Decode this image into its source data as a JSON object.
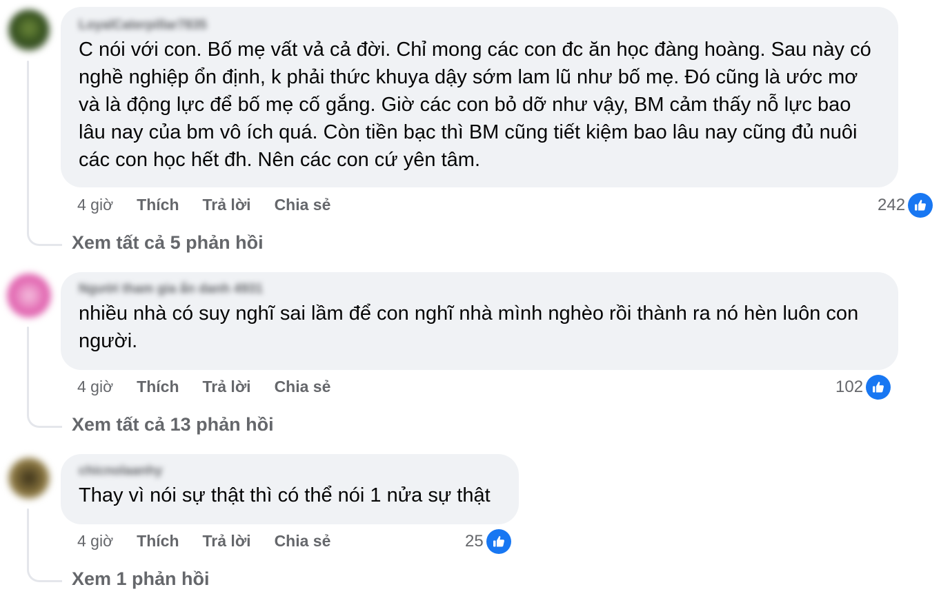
{
  "comments": [
    {
      "author": "LoyalCaterpillar7835",
      "text": "C nói với con. Bố mẹ vất vả cả đời. Chỉ mong các con đc ăn học đàng hoàng. Sau này có nghề nghiệp ổn định, k phải thức khuya dậy sớm lam lũ như bố mẹ. Đó cũng là ước mơ và là động lực để bố mẹ cố gắng. Giờ các con bỏ dỡ như vậy, BM cảm thấy nỗ lực bao lâu nay của bm vô ích quá. Còn tiền bạc thì BM cũng tiết kiệm bao lâu nay cũng đủ nuôi các con học hết đh. Nên các con cứ yên tâm.",
      "time": "4 giờ",
      "like_label": "Thích",
      "reply_label": "Trả lời",
      "share_label": "Chia sẻ",
      "reaction_count": "242",
      "view_replies": "Xem tất cả 5 phản hồi",
      "avatar_color": "#3c5a2a"
    },
    {
      "author": "Người tham gia ẩn danh 4931",
      "text": "nhiều nhà có suy nghĩ sai lầm để con nghĩ nhà mình nghèo rồi thành ra nó hèn luôn con người.",
      "time": "4 giờ",
      "like_label": "Thích",
      "reply_label": "Trả lời",
      "share_label": "Chia sẻ",
      "reaction_count": "102",
      "view_replies": "Xem tất cả 13 phản hồi",
      "avatar_color": "#e86fb7"
    },
    {
      "author": "chicnolaanhy",
      "text": "Thay vì nói sự thật thì có thể nói 1 nửa sự thật",
      "time": "4 giờ",
      "like_label": "Thích",
      "reply_label": "Trả lời",
      "share_label": "Chia sẻ",
      "reaction_count": "25",
      "view_replies": "Xem 1 phản hồi",
      "avatar_color": "#6b5a2c"
    }
  ],
  "colors": {
    "like_blue": "#1877f2",
    "bubble_bg": "#f0f2f5",
    "meta_gray": "#65676b"
  },
  "icons": {
    "reaction": "thumbs-up-icon"
  }
}
